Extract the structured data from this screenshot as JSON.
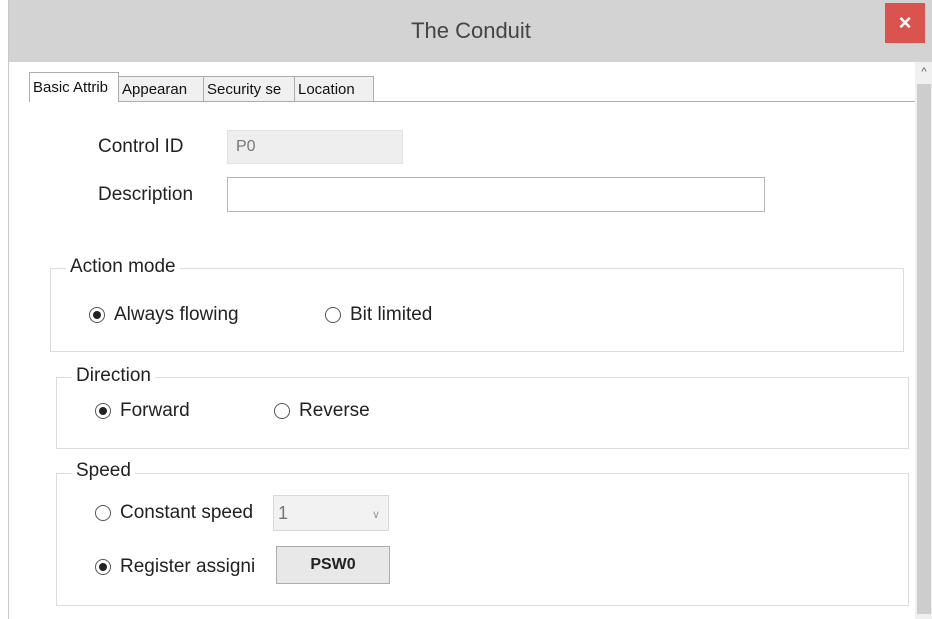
{
  "window": {
    "title": "The Conduit",
    "close_icon": "×"
  },
  "tabs": [
    {
      "label": "Basic Attrib",
      "active": true
    },
    {
      "label": "Appearan",
      "active": false
    },
    {
      "label": "Security se",
      "active": false
    },
    {
      "label": "Location",
      "active": false
    }
  ],
  "basic": {
    "control_id_label": "Control ID",
    "control_id_value": "P0",
    "description_label": "Description",
    "description_value": ""
  },
  "action_mode": {
    "title": "Action mode",
    "options": [
      {
        "label": "Always flowing",
        "selected": true
      },
      {
        "label": "Bit limited",
        "selected": false
      }
    ]
  },
  "direction": {
    "title": "Direction",
    "options": [
      {
        "label": "Forward",
        "selected": true
      },
      {
        "label": "Reverse",
        "selected": false
      }
    ]
  },
  "speed": {
    "title": "Speed",
    "constant_label": "Constant speed",
    "constant_selected": false,
    "constant_value": "1",
    "register_label": "Register assigni",
    "register_selected": true,
    "register_button": "PSW0"
  },
  "scroll": {
    "up_icon": "^"
  },
  "colors": {
    "close_bg": "#d9534f",
    "titlebar": "#d3d3d3"
  }
}
